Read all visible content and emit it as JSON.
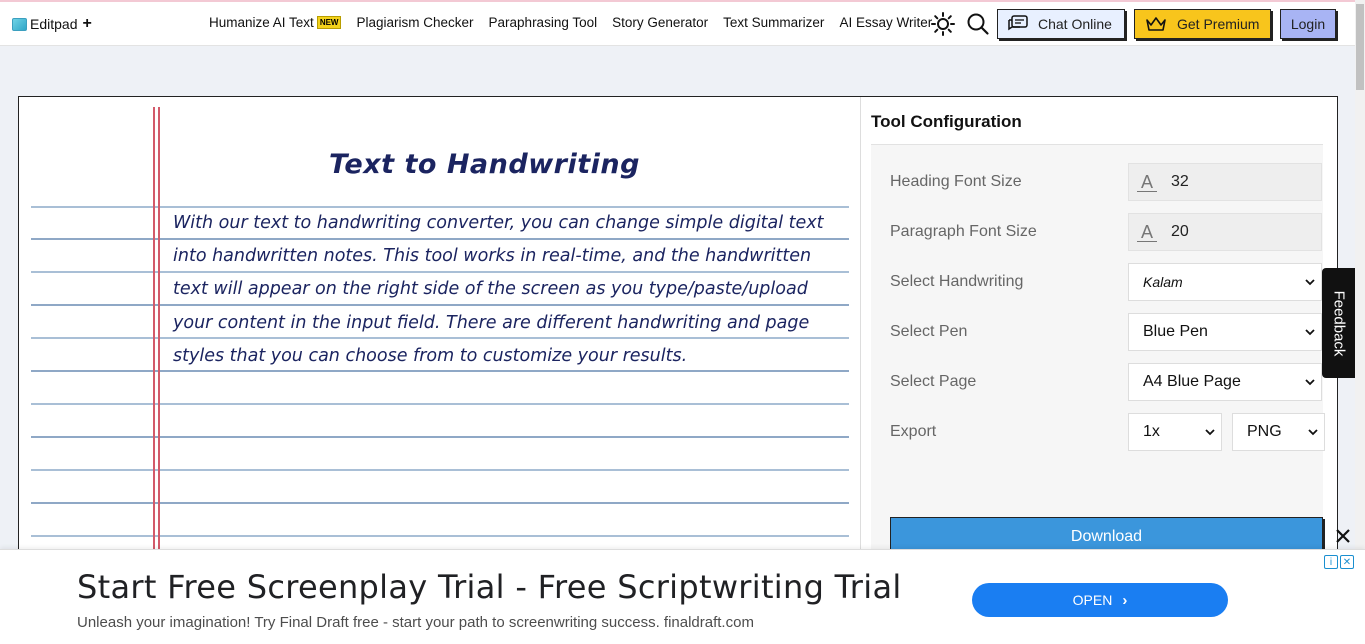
{
  "nav": {
    "logo": "Editpad",
    "plus": "+",
    "links": [
      {
        "label": "Humanize AI Text",
        "badge": "NEW"
      },
      {
        "label": "Plagiarism Checker"
      },
      {
        "label": "Paraphrasing Tool"
      },
      {
        "label": "Story Generator"
      },
      {
        "label": "Text Summarizer"
      },
      {
        "label": "AI Essay Writer"
      }
    ],
    "chat": "Chat Online",
    "premium": "Get Premium",
    "login": "Login"
  },
  "paper": {
    "title": "Text to Handwriting",
    "paragraph": "With our text to handwriting converter, you can change simple digital text into handwritten notes. This tool works in real-time, and the handwritten text will appear on the right side of the screen as you type/paste/upload your content in the input field. There are different handwriting and page styles that you can choose from to customize your results."
  },
  "config": {
    "title": "Tool Configuration",
    "heading_font_size": {
      "label": "Heading Font Size",
      "value": "32"
    },
    "paragraph_font_size": {
      "label": "Paragraph Font Size",
      "value": "20"
    },
    "handwriting": {
      "label": "Select Handwriting",
      "value": "Kalam"
    },
    "pen": {
      "label": "Select Pen",
      "value": "Blue Pen"
    },
    "page": {
      "label": "Select Page",
      "value": "A4 Blue Page"
    },
    "export": {
      "label": "Export",
      "scale": "1x",
      "format": "PNG"
    },
    "download": "Download"
  },
  "feedback": "Feedback",
  "ad": {
    "headline": "Start Free Screenplay Trial - Free Scriptwriting Trial",
    "sub": "Unleash your imagination! Try Final Draft free - start your path to screenwriting success. finaldraft.com",
    "cta": "OPEN"
  },
  "colors": {
    "accent_blue": "#3b96dc",
    "premium_yellow": "#f8c51c",
    "login_purple": "#a8b4f4",
    "ink": "#1b2460"
  }
}
